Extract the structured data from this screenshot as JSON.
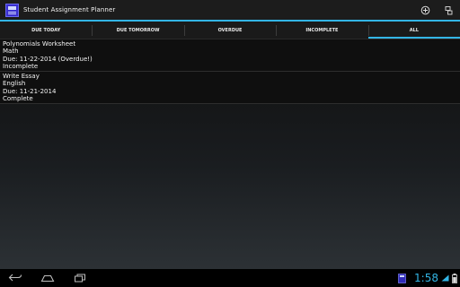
{
  "app": {
    "title": "Student Assignment Planner",
    "actions": [
      {
        "icon": "add-circle-icon"
      },
      {
        "icon": "overflow-menu-icon"
      }
    ]
  },
  "tabs": [
    {
      "label": "DUE TODAY",
      "selected": false
    },
    {
      "label": "DUE TOMORROW",
      "selected": false
    },
    {
      "label": "OVERDUE",
      "selected": false
    },
    {
      "label": "INCOMPLETE",
      "selected": false
    },
    {
      "label": "ALL",
      "selected": true
    }
  ],
  "assignments": [
    {
      "title": "Polynomials Worksheet",
      "subject": "Math",
      "due": "Due: 11-22-2014 (Overdue!)",
      "status": "Incomplete"
    },
    {
      "title": "Write Essay",
      "subject": "English",
      "due": "Due: 11-21-2014",
      "status": "Complete"
    }
  ],
  "system_bar": {
    "nav": [
      "back-icon",
      "home-icon",
      "recent-apps-icon"
    ],
    "time": "1:58"
  },
  "colors": {
    "accent": "#33b5e5",
    "action_bar": "#1c1c1c",
    "app_icon": "#3a2fd0"
  }
}
